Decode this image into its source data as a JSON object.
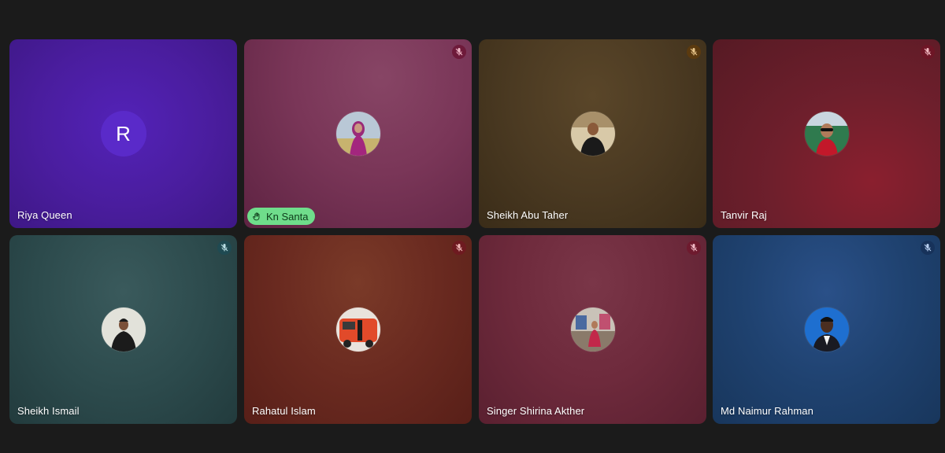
{
  "participants": [
    {
      "name": "Riya Queen",
      "initial": "R",
      "muted": false,
      "hand_raised": false,
      "avatar_icon": "letter-avatar",
      "bg": "#4a1fa6",
      "accent": "#5a2ac9"
    },
    {
      "name": "Kn Santa",
      "muted": true,
      "hand_raised": true,
      "avatar_icon": "profile-photo-icon",
      "bg": "#7a3658",
      "mute_bg": "#6e1a3a"
    },
    {
      "name": "Sheikh Abu Taher",
      "muted": true,
      "hand_raised": false,
      "avatar_icon": "profile-photo-icon",
      "bg": "#4b3a22",
      "mute_bg": "#5b3a0f"
    },
    {
      "name": "Tanvir Raj",
      "muted": true,
      "hand_raised": false,
      "avatar_icon": "profile-photo-icon",
      "bg": "#6e1f2c",
      "mute_bg": "#6e1626"
    },
    {
      "name": "Sheikh Ismail",
      "muted": true,
      "hand_raised": false,
      "avatar_icon": "profile-photo-icon",
      "bg": "#2c4a4c",
      "mute_bg": "#1f4a52"
    },
    {
      "name": "Rahatul Islam",
      "muted": true,
      "hand_raised": false,
      "avatar_icon": "profile-photo-icon",
      "bg": "#6a2a20",
      "mute_bg": "#6e1a20"
    },
    {
      "name": "Singer Shirina Akther",
      "muted": true,
      "hand_raised": false,
      "avatar_icon": "profile-photo-icon",
      "bg": "#6e2a3c",
      "mute_bg": "#6e1a2e"
    },
    {
      "name": "Md Naimur Rahman",
      "muted": true,
      "hand_raised": false,
      "avatar_icon": "profile-photo-icon",
      "bg": "#1f4270",
      "mute_bg": "#17325a"
    }
  ],
  "colors": {
    "page_bg": "#1b1b1b",
    "hand_badge_bg": "#6fdd8b",
    "hand_badge_text": "#0e3b1a"
  }
}
